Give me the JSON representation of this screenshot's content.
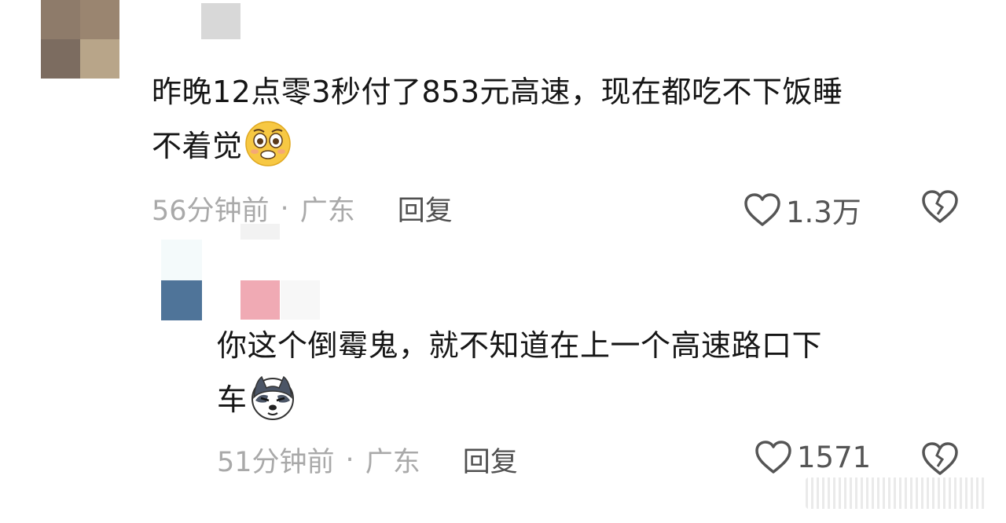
{
  "comments": [
    {
      "text_line1": "昨晚12点零3秒付了853元高速，现在都吃不下饭睡",
      "text_line2": "不着觉",
      "emoji": "pleading-face-emoji",
      "time": "56分钟前",
      "location": "广东",
      "reply_label": "回复",
      "like_count": "1.3万"
    },
    {
      "text_line1": "你这个倒霉鬼，就不知道在上一个高速路口下",
      "text_line2": "车",
      "emoji": "husky-dog-emoji",
      "time": "51分钟前",
      "location": "广东",
      "reply_label": "回复",
      "like_count": "1571"
    }
  ],
  "separator": "·",
  "icons": {
    "like": "heart-outline-icon",
    "dislike": "broken-heart-icon"
  },
  "colors": {
    "text": "#161616",
    "meta": "#a9a9a9",
    "reply": "#505050",
    "emoji_yellow": "#f7c843"
  }
}
